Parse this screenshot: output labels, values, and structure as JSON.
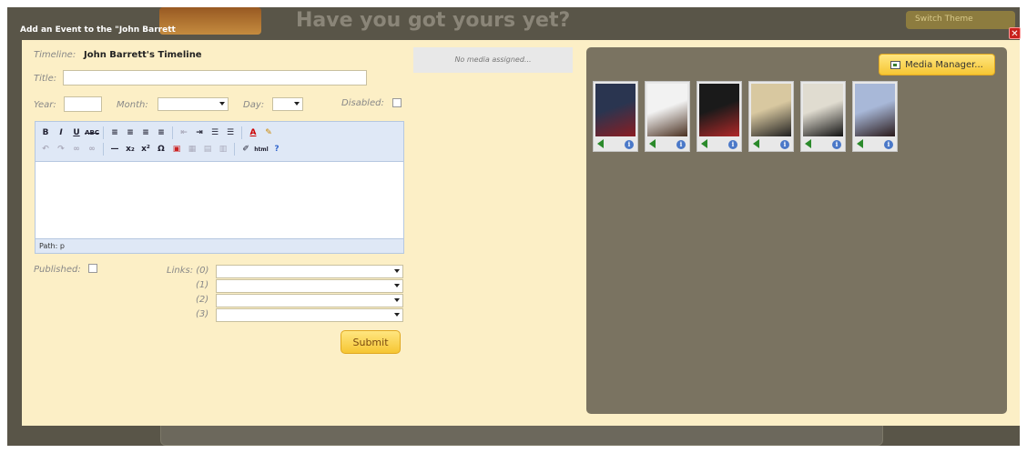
{
  "backdrop": {
    "tagline": "Have you got yours yet?",
    "theme_button": "Switch Theme"
  },
  "dialog": {
    "title": "Add an Event to the \"John Barrett",
    "close_icon": "close-icon"
  },
  "form": {
    "timeline_label": "Timeline:",
    "timeline_name": "John Barrett's Timeline",
    "title_label": "Title:",
    "title_value": "",
    "year_label": "Year:",
    "year_value": "",
    "month_label": "Month:",
    "month_value": "",
    "day_label": "Day:",
    "day_value": "",
    "disabled_label": "Disabled:",
    "disabled_checked": false,
    "editor_path": "Path: p",
    "published_label": "Published:",
    "published_checked": false,
    "links_label": "Links: (0)",
    "link1_label": "(1)",
    "link2_label": "(2)",
    "link3_label": "(3)",
    "submit_label": "Submit"
  },
  "toolbar": {
    "row1": [
      "B",
      "I",
      "U",
      "ABC",
      "align-left-icon",
      "align-center-icon",
      "align-right-icon",
      "justify-icon",
      "outdent-icon",
      "indent-icon",
      "bullet-list-icon",
      "numbered-list-icon",
      "font-color-icon",
      "highlight-icon"
    ],
    "row2": [
      "undo-icon",
      "redo-icon",
      "link-icon",
      "unlink-icon",
      "horizontal-rule-icon",
      "subscript-icon",
      "superscript-icon",
      "special-char-icon",
      "image-icon",
      "table-icon",
      "cleanup-icon",
      "html-icon",
      "help-icon"
    ]
  },
  "media": {
    "no_media": "No media assigned...",
    "manager_button": "Media Manager...",
    "thumbnails": [
      {
        "name": "group-photo-1",
        "colors": [
          "#2a3550",
          "#8a1d22"
        ]
      },
      {
        "name": "cake-photo",
        "colors": [
          "#f2f2f2",
          "#4a3020"
        ]
      },
      {
        "name": "group-photo-2",
        "colors": [
          "#1a1a1a",
          "#b02828"
        ]
      },
      {
        "name": "couple-photo-1",
        "colors": [
          "#d8c8a0",
          "#202020"
        ]
      },
      {
        "name": "person-photo",
        "colors": [
          "#e0dcd0",
          "#111111"
        ]
      },
      {
        "name": "couple-photo-2",
        "colors": [
          "#a8b8d8",
          "#2a1a1a"
        ]
      }
    ]
  }
}
